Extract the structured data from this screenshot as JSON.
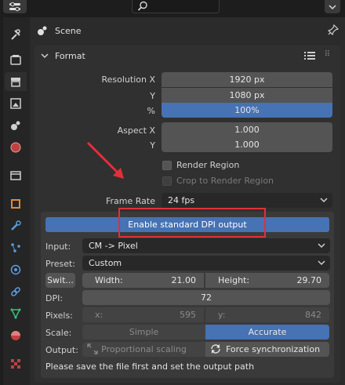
{
  "header": {
    "title": "Scene"
  },
  "format_panel": {
    "title": "Format",
    "resolution_x_label": "Resolution X",
    "resolution_x": "1920 px",
    "resolution_y_label": "Y",
    "resolution_y": "1080 px",
    "percent_label": "%",
    "percent": "100%",
    "aspect_x_label": "Aspect X",
    "aspect_x": "1.000",
    "aspect_y_label": "Y",
    "aspect_y": "1.000",
    "render_region_label": "Render Region",
    "crop_label": "Crop to Render Region",
    "frame_rate_label": "Frame Rate",
    "frame_rate": "24 fps"
  },
  "dpi_panel": {
    "enable_button": "Enable standard DPI output",
    "input_label": "Input:",
    "input_value": "CM -> Pixel",
    "preset_label": "Preset:",
    "preset_value": "Custom",
    "switch_button": "Swit...",
    "width_label": "Width:",
    "width_value": "21.00",
    "height_label": "Height:",
    "height_value": "29.70",
    "dpi_label": "DPI:",
    "dpi_value": "72",
    "pixels_label": "Pixels:",
    "px_x_label": "x:",
    "px_x_value": "595",
    "px_y_label": "y:",
    "px_y_value": "842",
    "scale_label": "Scale:",
    "scale_simple": "Simple",
    "scale_accurate": "Accurate",
    "output_label": "Output:",
    "proportional": "Proportional scaling",
    "force_sync": "Force synchronization",
    "note": "Please save the file first and set the output path"
  },
  "colors": {
    "accent": "#4772b3",
    "highlight": "#e0303a",
    "panel": "#303030"
  },
  "icons": [
    "editor-type-icon",
    "search-icon",
    "chevron-down-icon",
    "tool-icon",
    "render-icon",
    "output-icon",
    "view-layer-icon",
    "scene-icon",
    "world-icon",
    "collection-icon",
    "object-icon",
    "modifier-icon",
    "particles-icon",
    "physics-icon",
    "constraints-icon",
    "data-icon",
    "material-icon",
    "texture-icon",
    "pin-icon",
    "list-icon"
  ]
}
